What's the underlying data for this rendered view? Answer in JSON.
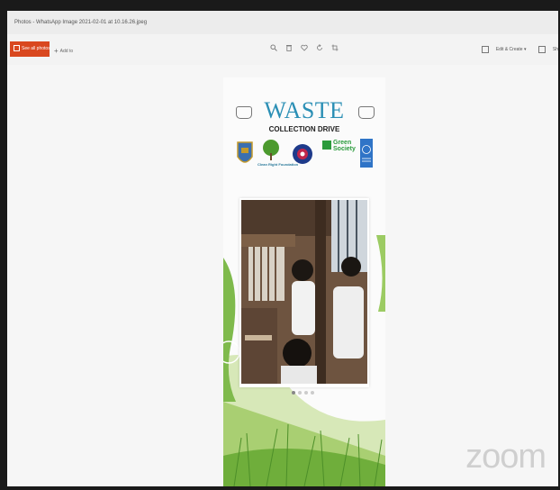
{
  "window": {
    "title": "Photos - WhatsApp Image 2021-02-01 at 10.16.26.jpeg"
  },
  "toolbar": {
    "see_all_photos": "See all photos",
    "add_to": "Add to",
    "tool_icons": [
      "zoom-icon",
      "delete-icon",
      "favorite-icon",
      "rotate-icon",
      "crop-icon"
    ],
    "edit_create": "Edit & Create",
    "share": "Sh"
  },
  "poster": {
    "heading": "WASTE",
    "subheading": "COLLECTION DRIVE",
    "partner_text_1": "Green Society",
    "partner_text_2": "Clean Right Foundation"
  },
  "carousel": {
    "dot_count": 4,
    "active_index": 0
  },
  "watermark": "zoom",
  "colors": {
    "accent": "#d9481f",
    "waste_blue": "#2b8fb5",
    "green": "#2b9b3c"
  }
}
